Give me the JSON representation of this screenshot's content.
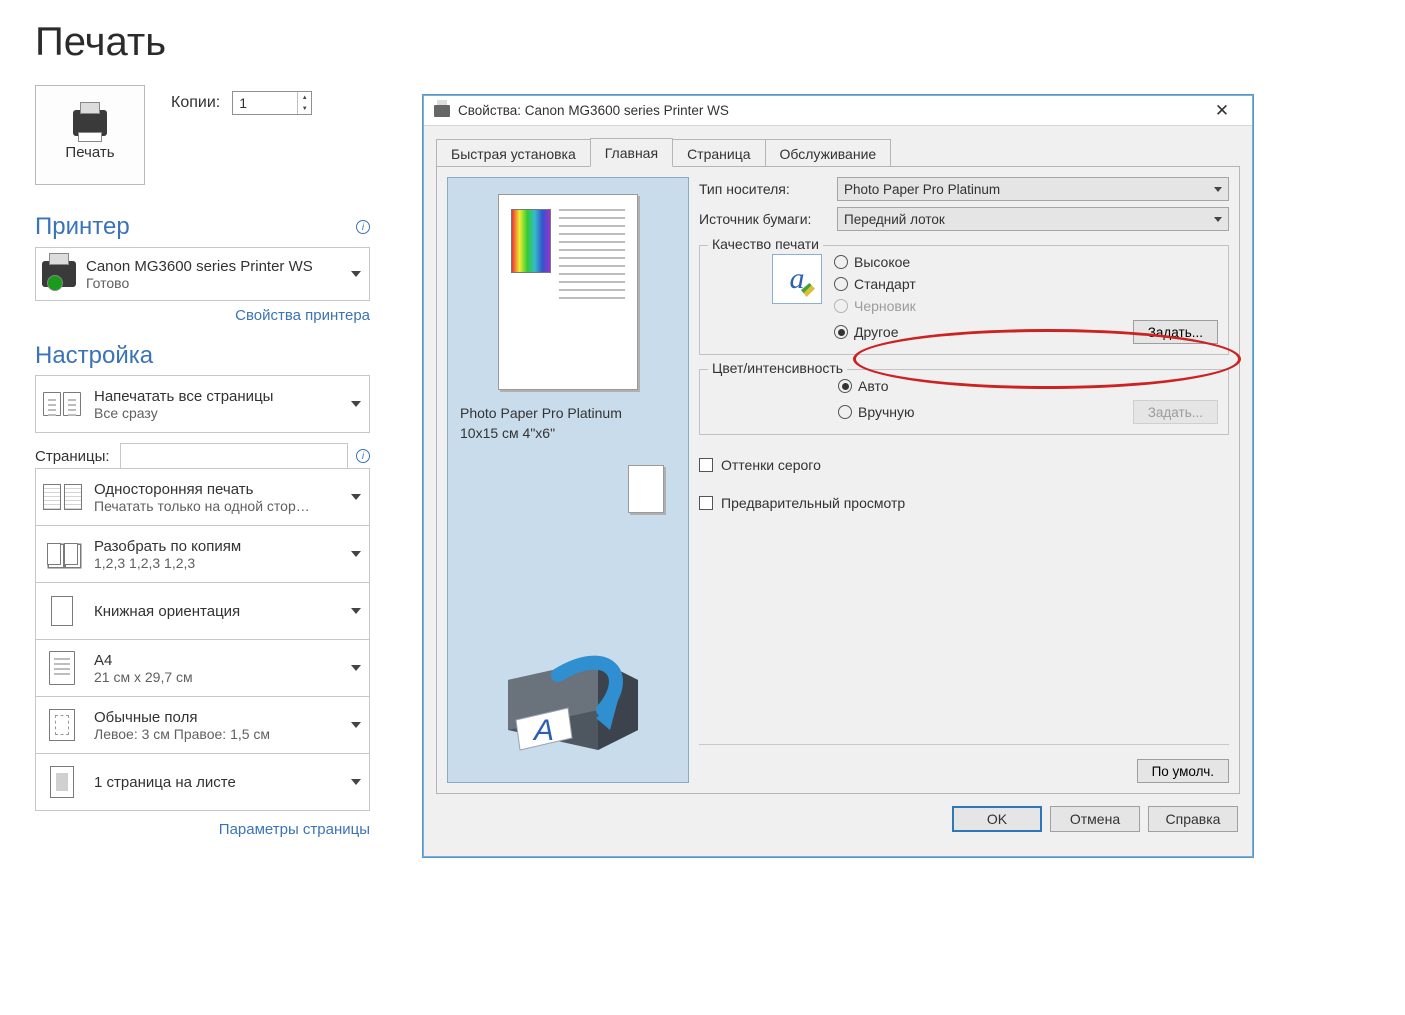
{
  "page": {
    "title": "Печать"
  },
  "print_button": {
    "label": "Печать"
  },
  "copies": {
    "label": "Копии:",
    "value": "1"
  },
  "printer_section": {
    "header": "Принтер",
    "name": "Canon MG3600 series Printer WS",
    "status": "Готово",
    "props_link": "Свойства принтера"
  },
  "settings_section": {
    "header": "Настройка",
    "pages_label": "Страницы:",
    "pages_value": "",
    "params_link": "Параметры страницы",
    "options": [
      {
        "t1": "Напечатать все страницы",
        "t2": "Все сразу"
      },
      {
        "t1": "Односторонняя печать",
        "t2": "Печатать только на одной стор…"
      },
      {
        "t1": "Разобрать по копиям",
        "t2": "1,2,3    1,2,3    1,2,3"
      },
      {
        "t1": "Книжная ориентация",
        "t2": ""
      },
      {
        "t1": "A4",
        "t2": "21 см x 29,7 см"
      },
      {
        "t1": "Обычные поля",
        "t2": "Левое:  3 см    Правое:  1,5 см"
      },
      {
        "t1": "1 страница на листе",
        "t2": ""
      }
    ]
  },
  "dialog": {
    "title": "Свойства: Canon MG3600 series Printer WS",
    "tabs": [
      "Быстрая установка",
      "Главная",
      "Страница",
      "Обслуживание"
    ],
    "active_tab": 1,
    "media": {
      "label": "Тип носителя:",
      "value": "Photo Paper Pro Platinum"
    },
    "source": {
      "label": "Источник бумаги:",
      "value": "Передний лоток"
    },
    "preview_caption_line1": "Photo Paper Pro Platinum",
    "preview_caption_line2": "10x15 см 4\"x6\"",
    "quality": {
      "legend": "Качество печати",
      "options": [
        "Высокое",
        "Стандарт",
        "Черновик",
        "Другое"
      ],
      "selected": "Другое",
      "disabled": [
        "Черновик"
      ],
      "set_button": "Задать..."
    },
    "color": {
      "legend": "Цвет/интенсивность",
      "options": [
        "Авто",
        "Вручную"
      ],
      "selected": "Авто",
      "set_button": "Задать..."
    },
    "grayscale": {
      "label": "Оттенки серого",
      "checked": false
    },
    "preview": {
      "label": "Предварительный просмотр",
      "checked": false
    },
    "defaults_button": "По умолч.",
    "buttons": {
      "ok": "OK",
      "cancel": "Отмена",
      "help": "Справка"
    }
  }
}
